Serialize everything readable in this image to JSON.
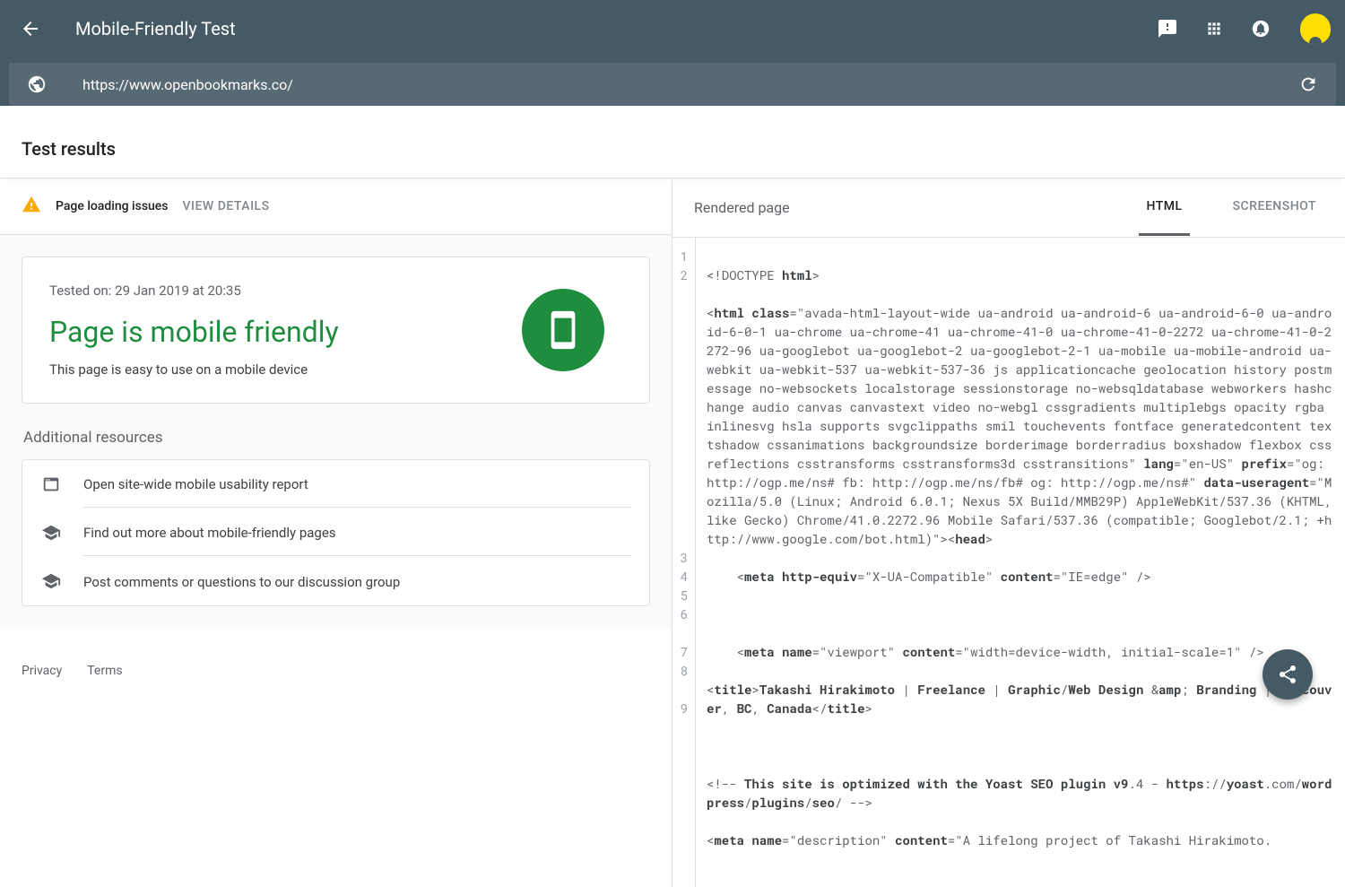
{
  "header": {
    "title": "Mobile-Friendly Test"
  },
  "url": "https://www.openbookmarks.co/",
  "section_title": "Test results",
  "issues": {
    "label": "Page loading issues",
    "action": "VIEW DETAILS"
  },
  "result": {
    "tested_on": "Tested on: 29 Jan 2019 at 20:35",
    "verdict": "Page is mobile friendly",
    "sub": "This page is easy to use on a mobile device"
  },
  "resources": {
    "title": "Additional resources",
    "items": [
      "Open site-wide mobile usability report",
      "Find out more about mobile-friendly pages",
      "Post comments or questions to our discussion group"
    ]
  },
  "footer": {
    "privacy": "Privacy",
    "terms": "Terms"
  },
  "right": {
    "title": "Rendered page",
    "tabs": {
      "html": "HTML",
      "screenshot": "SCREENSHOT"
    }
  },
  "code": {
    "l1_a": "<!DOCTYPE ",
    "l1_b": "html",
    "l1_c": ">",
    "l2_a": "<",
    "l2_b": "html class",
    "l2_c": "=\"avada-html-layout-wide ua-android ua-android-6 ua-android-6-0 ua-android-6-0-1 ua-chrome ua-chrome-41 ua-chrome-41-0 ua-chrome-41-0-2272 ua-chrome-41-0-2272-96 ua-googlebot ua-googlebot-2 ua-googlebot-2-1 ua-mobile ua-mobile-android ua-webkit ua-webkit-537 ua-webkit-537-36 js applicationcache geolocation history postmessage no-websockets localstorage sessionstorage no-websqldatabase webworkers hashchange audio canvas canvastext video no-webgl cssgradients multiplebgs opacity rgba inlinesvg hsla supports svgclippaths smil touchevents fontface generatedcontent textshadow cssanimations backgroundsize borderimage borderradius boxshadow flexbox cssreflections csstransforms csstransforms3d csstransitions\" ",
    "l2_d": "lang",
    "l2_e": "=\"en-US\" ",
    "l2_f": "prefix",
    "l2_g": "=\"og: http://ogp.me/ns# fb: http://ogp.me/ns/fb# og: http://ogp.me/ns#\" ",
    "l2_h": "data-useragent",
    "l2_i": "=\"Mozilla/5.0 (Linux; Android 6.0.1; Nexus 5X Build/MMB29P) AppleWebKit/537.36 (KHTML, like Gecko) Chrome/41.0.2272.96 Mobile Safari/537.36 (compatible; Googlebot/2.1; +http://www.google.com/bot.html)\"><",
    "l2_j": "head",
    "l2_k": ">",
    "l3_a": "    <",
    "l3_b": "meta http-equiv",
    "l3_c": "=\"X-UA-Compatible\" ",
    "l3_d": "content",
    "l3_e": "=\"IE=edge\" />",
    "l5_a": "    <",
    "l5_b": "meta name",
    "l5_c": "=\"viewport\" ",
    "l5_d": "content",
    "l5_e": "=\"width=device-width, initial-scale=1\" />",
    "l6_a": "    <",
    "l6_b": "title",
    "l6_c": ">",
    "l6_d": "Takashi Hirakimoto ",
    "l6_e": "| ",
    "l6_f": "Freelance ",
    "l6_g": "| ",
    "l6_h": "Graphic",
    "l6_i": "/",
    "l6_j": "Web Design ",
    "l6_k": "&",
    "l6_l": "amp",
    "l6_m": "; ",
    "l6_n": "Branding ",
    "l6_o": "| ",
    "l6_p": "Vancouver",
    "l6_q": ", ",
    "l6_r": "BC",
    "l6_s": ", ",
    "l6_t": "Canada",
    "l6_u": "</",
    "l6_v": "title",
    "l6_w": ">",
    "l8_a": "<!-- ",
    "l8_b": "This site is optimized with the Yoast SEO plugin v9",
    "l8_c": ".4 - ",
    "l8_d": "https",
    "l8_e": "://",
    "l8_f": "yoast",
    "l8_g": ".com/",
    "l8_h": "wordpress",
    "l8_i": "/",
    "l8_j": "plugins",
    "l8_k": "/",
    "l8_l": "seo",
    "l8_m": "/ -->",
    "l9_a": "<",
    "l9_b": "meta name",
    "l9_c": "=\"description\" ",
    "l9_d": "content",
    "l9_e": "=\"A lifelong project of Takashi Hirakimoto."
  }
}
